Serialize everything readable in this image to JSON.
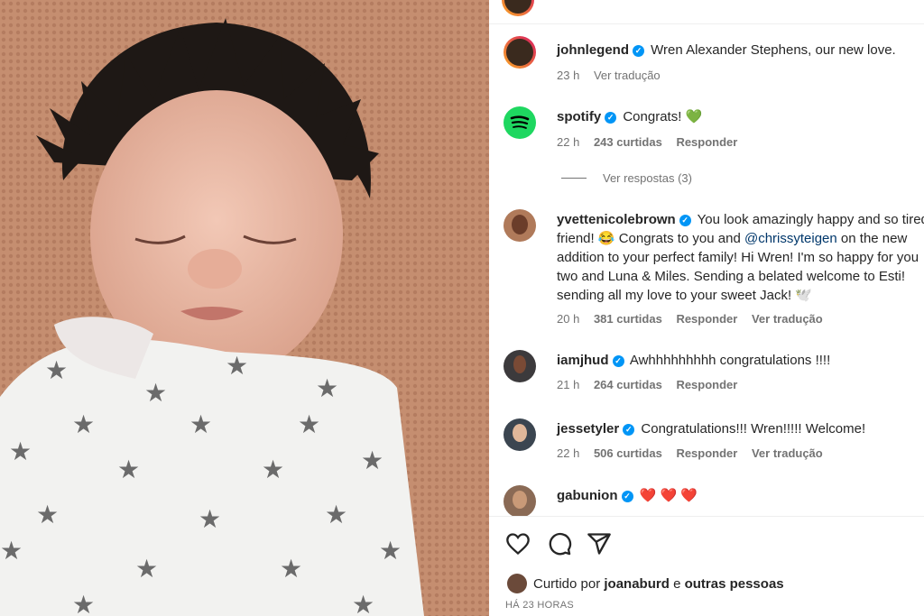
{
  "post": {
    "author": "johnlegend",
    "caption": "Wren Alexander Stephens, our new love.",
    "caption_time": "23 h",
    "caption_translate": "Ver tradução"
  },
  "comments": [
    {
      "user": "spotify",
      "text": "Congrats! 💚",
      "time": "22 h",
      "likes": "243 curtidas",
      "reply": "Responder",
      "replies": "Ver respostas (3)"
    },
    {
      "user": "yvettenicolebrown",
      "lines": [
        "You look amazingly happy and so tired, my",
        "friend! 😂 Congrats to you and",
        "addition to your perfect family! Hi Wren! I'm so happy for you",
        "two and Luna & Miles. Sending a belated welcome to Esti!",
        "sending all my love to your sweet Jack! 🕊️"
      ],
      "mention": "@chrissyteigen",
      "mention_after": "on the new",
      "time": "20 h",
      "likes": "381 curtidas",
      "reply": "Responder",
      "translate": "Ver tradução"
    },
    {
      "user": "iamjhud",
      "text": "Awhhhhhhhhh congratulations !!!!",
      "time": "21 h",
      "likes": "264 curtidas",
      "reply": "Responder"
    },
    {
      "user": "jessetyler",
      "text": "Congratulations!!! Wren!!!!! Welcome!",
      "time": "22 h",
      "likes": "506 curtidas",
      "reply": "Responder",
      "translate": "Ver tradução"
    },
    {
      "user": "gabunion",
      "text": "❤️ ❤️ ❤️"
    }
  ],
  "footer": {
    "liked_prefix": "Curtido por",
    "liked_user": "joanaburd",
    "liked_and": "e",
    "liked_others": "outras pessoas",
    "time": "HÁ 23 HORAS"
  },
  "icons": [
    "heart-icon",
    "comment-icon",
    "share-icon",
    "verified-icon"
  ],
  "colors": {
    "verified": "#0095f6",
    "spotify": "#1ed760",
    "muted": "#737373"
  }
}
